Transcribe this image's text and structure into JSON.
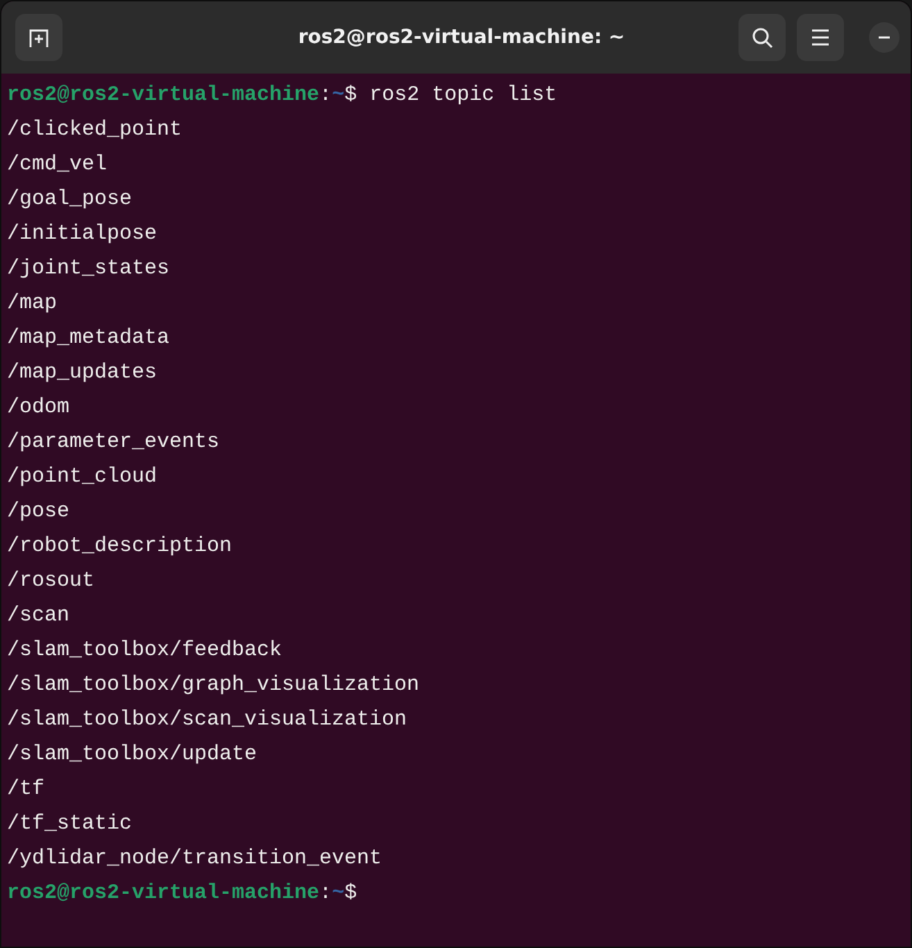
{
  "window": {
    "title": "ros2@ros2-virtual-machine: ~"
  },
  "terminal": {
    "lines": [
      {
        "kind": "prompt",
        "user_host": "ros2@ros2-virtual-machine",
        "separator": ":",
        "path": "~",
        "symbol": "$",
        "command": "ros2 topic list"
      },
      {
        "kind": "output",
        "text": "/clicked_point"
      },
      {
        "kind": "output",
        "text": "/cmd_vel"
      },
      {
        "kind": "output",
        "text": "/goal_pose"
      },
      {
        "kind": "output",
        "text": "/initialpose"
      },
      {
        "kind": "output",
        "text": "/joint_states"
      },
      {
        "kind": "output",
        "text": "/map"
      },
      {
        "kind": "output",
        "text": "/map_metadata"
      },
      {
        "kind": "output",
        "text": "/map_updates"
      },
      {
        "kind": "output",
        "text": "/odom"
      },
      {
        "kind": "output",
        "text": "/parameter_events"
      },
      {
        "kind": "output",
        "text": "/point_cloud"
      },
      {
        "kind": "output",
        "text": "/pose"
      },
      {
        "kind": "output",
        "text": "/robot_description"
      },
      {
        "kind": "output",
        "text": "/rosout"
      },
      {
        "kind": "output",
        "text": "/scan"
      },
      {
        "kind": "output",
        "text": "/slam_toolbox/feedback"
      },
      {
        "kind": "output",
        "text": "/slam_toolbox/graph_visualization"
      },
      {
        "kind": "output",
        "text": "/slam_toolbox/scan_visualization"
      },
      {
        "kind": "output",
        "text": "/slam_toolbox/update"
      },
      {
        "kind": "output",
        "text": "/tf"
      },
      {
        "kind": "output",
        "text": "/tf_static"
      },
      {
        "kind": "output",
        "text": "/ydlidar_node/transition_event"
      },
      {
        "kind": "prompt",
        "user_host": "ros2@ros2-virtual-machine",
        "separator": ":",
        "path": "~",
        "symbol": "$"
      }
    ]
  }
}
